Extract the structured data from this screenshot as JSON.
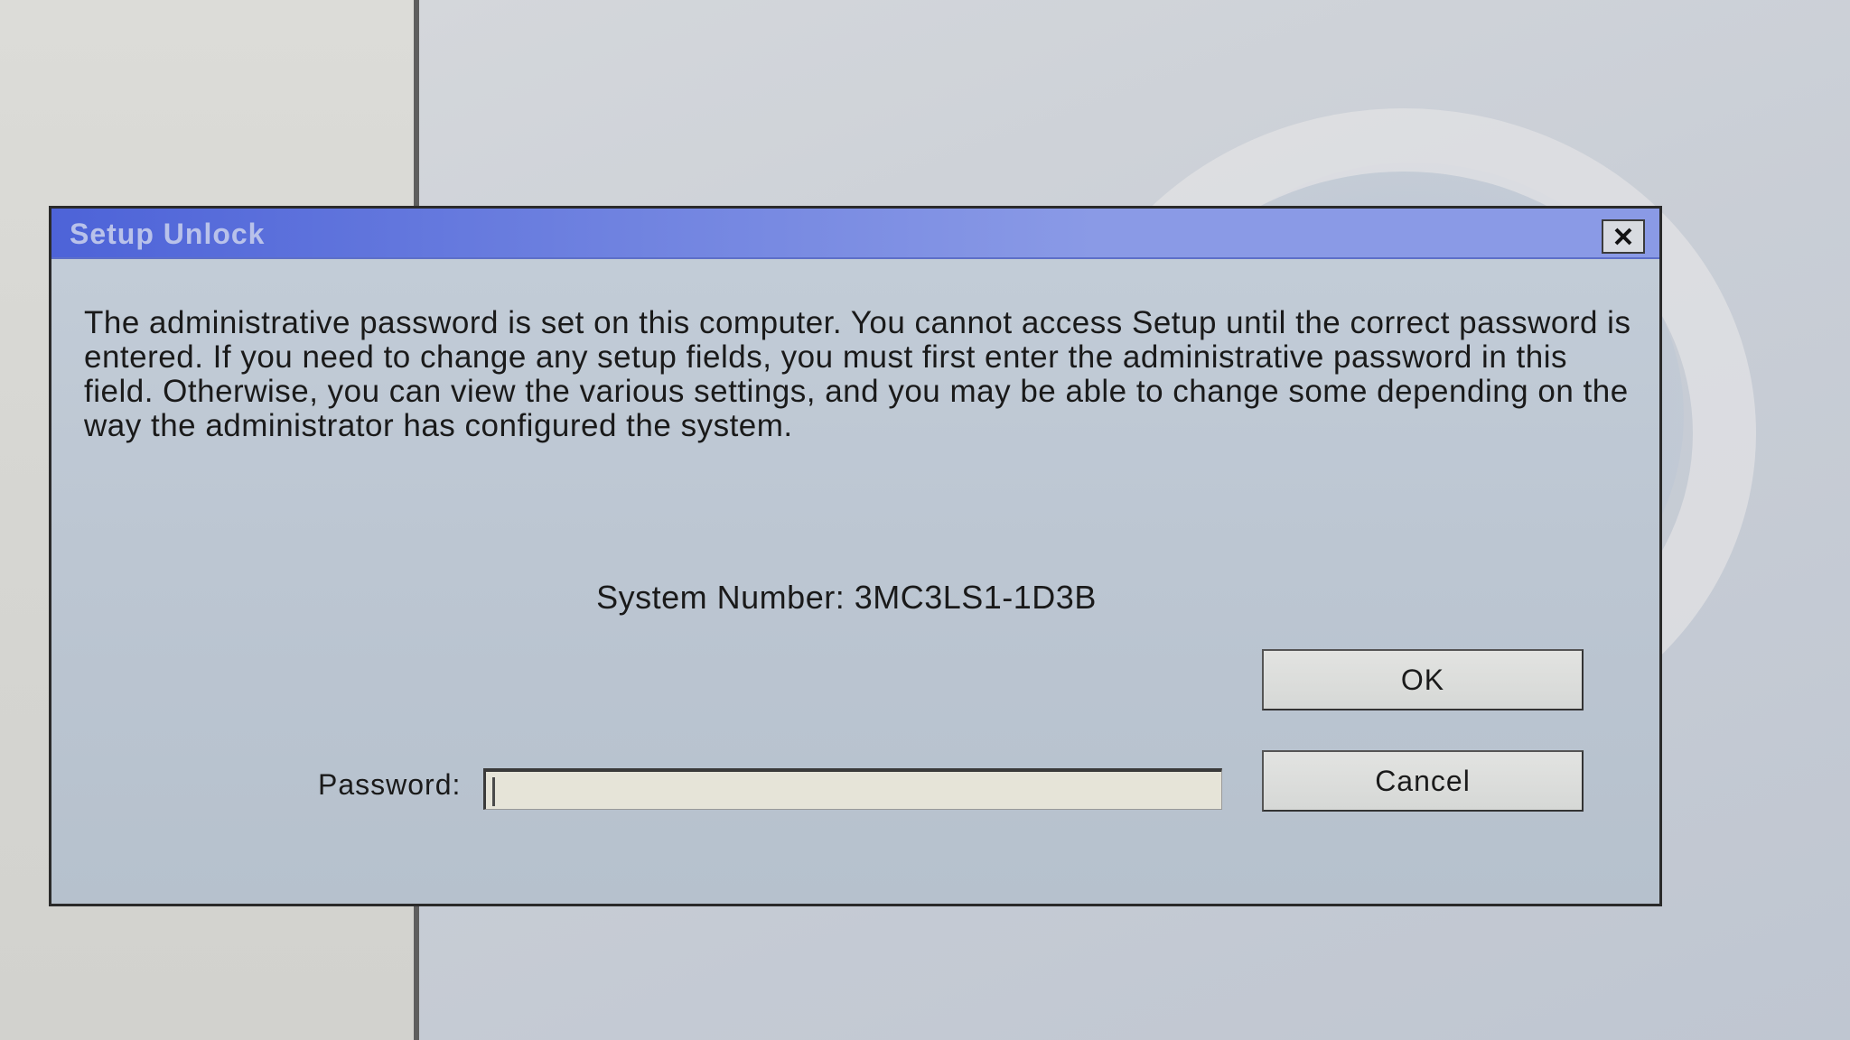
{
  "window": {
    "title": "Setup Unlock",
    "close_icon": "close-icon"
  },
  "message": "The administrative password is set on this computer.  You cannot access Setup until the correct password is entered.  If you need to change any setup fields, you must first enter the administrative password in this field.  Otherwise, you can view the various settings, and you may be able to change some depending on the way the administrator has configured the system.",
  "system_number": {
    "label": "System Number:",
    "value": "3MC3LS1-1D3B",
    "text": "System Number:  3MC3LS1-1D3B"
  },
  "buttons": {
    "ok_label": "OK",
    "cancel_label": "Cancel"
  },
  "password": {
    "label": "Password:",
    "value": "",
    "placeholder": ""
  },
  "colors": {
    "titlebar_start": "#4d63d8",
    "titlebar_end": "#8a9ae6",
    "dialog_bg": "#bcc6d2",
    "button_bg": "#d6d8d6",
    "field_bg": "#e6e4d8"
  }
}
